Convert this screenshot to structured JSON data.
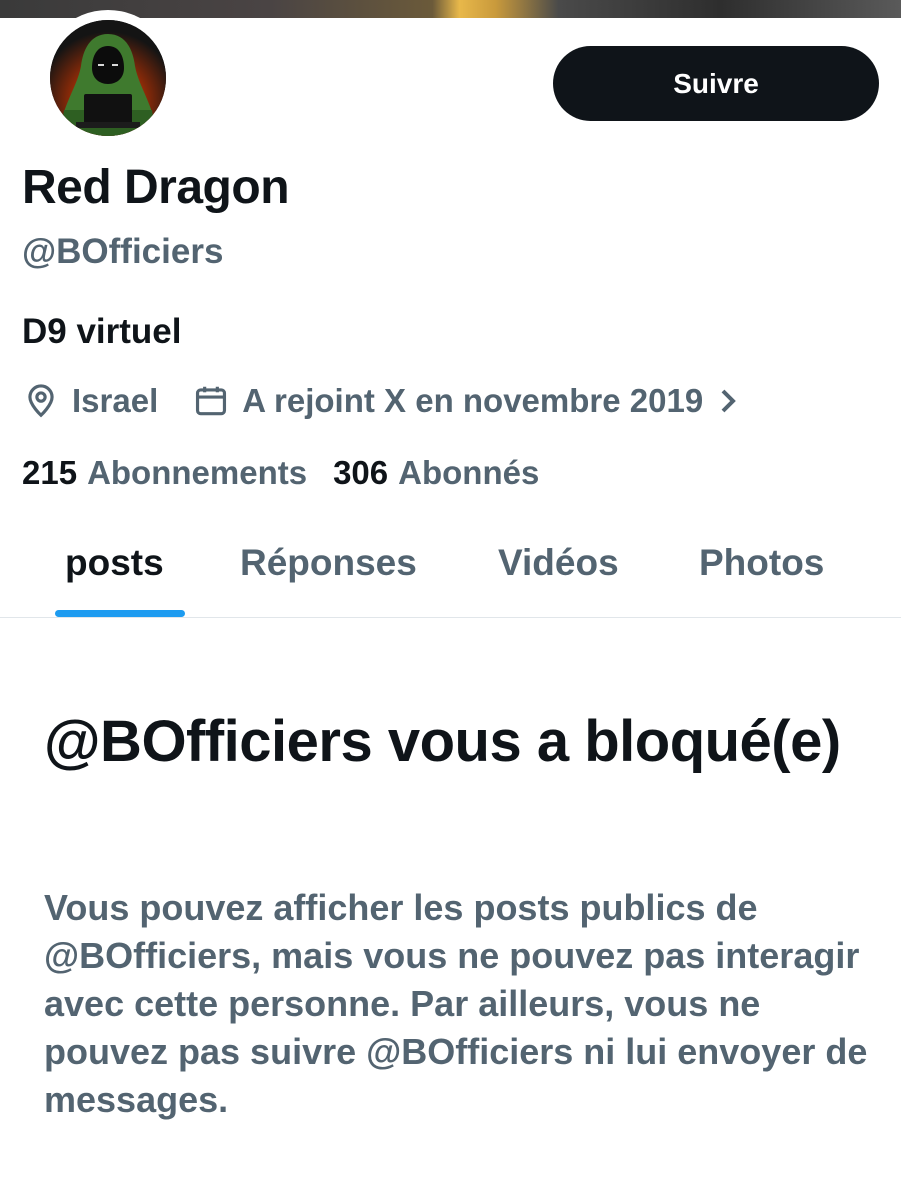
{
  "profile": {
    "display_name": "Red Dragon",
    "handle": "@BOfficiers",
    "bio": "D9 virtuel",
    "location": "Israel",
    "joined": "A rejoint X en novembre 2019",
    "following_count": "215",
    "following_label": "Abonnements",
    "followers_count": "306",
    "followers_label": "Abonnés"
  },
  "actions": {
    "follow_label": "Suivre"
  },
  "tabs": [
    {
      "label": "posts",
      "active": true
    },
    {
      "label": "Réponses",
      "active": false
    },
    {
      "label": "Vidéos",
      "active": false
    },
    {
      "label": "Photos",
      "active": false
    }
  ],
  "blocked": {
    "title": "@BOfficiers vous a bloqué(e)",
    "body": "Vous pouvez afficher les posts publics de @BOfficiers, mais vous ne pouvez pas interagir avec cette personne. Par ailleurs, vous ne pouvez pas suivre @BOfficiers ni lui envoyer de messages."
  },
  "icons": {
    "location": "location-pin-icon",
    "calendar": "calendar-icon",
    "chevron": "chevron-right-icon"
  },
  "colors": {
    "text_primary": "#0f1419",
    "text_secondary": "#536471",
    "accent": "#1d9bf0",
    "button_bg": "#0f1419"
  }
}
